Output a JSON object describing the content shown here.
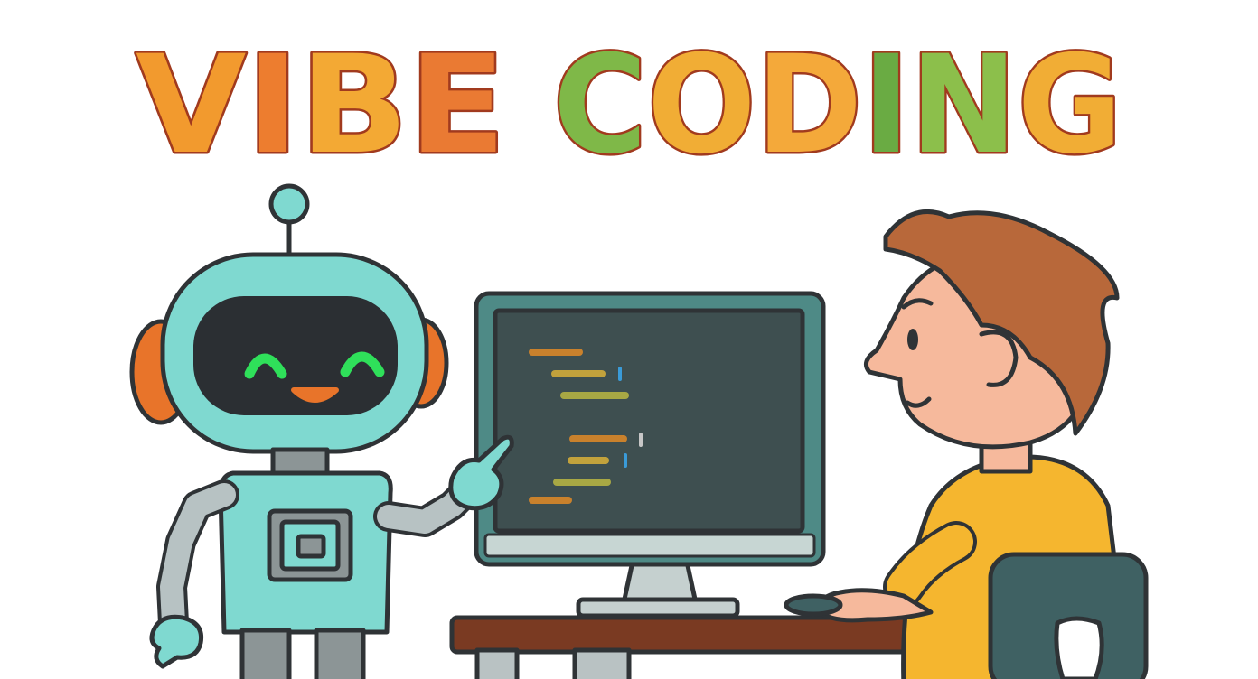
{
  "title": {
    "word1": "VIBE",
    "word2": "CODING",
    "letters": [
      {
        "char": "V",
        "color": "#f29a2e"
      },
      {
        "char": "I",
        "color": "#ed7d2f"
      },
      {
        "char": "B",
        "color": "#f3a934"
      },
      {
        "char": "E",
        "color": "#ea7a33"
      },
      {
        "char": "C",
        "color": "#7fb848"
      },
      {
        "char": "O",
        "color": "#f1ad35"
      },
      {
        "char": "D",
        "color": "#f4a93a"
      },
      {
        "char": "I",
        "color": "#6aab43"
      },
      {
        "char": "N",
        "color": "#8cbf4b"
      },
      {
        "char": "G",
        "color": "#f1ad35"
      }
    ]
  },
  "colors": {
    "robot_body": "#7fd9d0",
    "robot_visor": "#2b2f33",
    "robot_eyes": "#2fe05a",
    "robot_ears": "#e8742a",
    "monitor_frame": "#4e8a86",
    "monitor_screen": "#3e4f50",
    "desk": "#7a3a22",
    "hair": "#b8683a",
    "skin": "#f6b99c",
    "shirt": "#f5b62f",
    "chair": "#3f6163",
    "outline": "#2f3336"
  },
  "icons": {
    "robot": "robot-illustration",
    "computer": "computer-monitor-illustration",
    "person": "person-illustration",
    "desk": "desk-illustration",
    "chair": "chair-illustration"
  },
  "code_line_colors": [
    "#c9812c",
    "#c2a23c",
    "#a8a844",
    "#3a9bd8"
  ]
}
